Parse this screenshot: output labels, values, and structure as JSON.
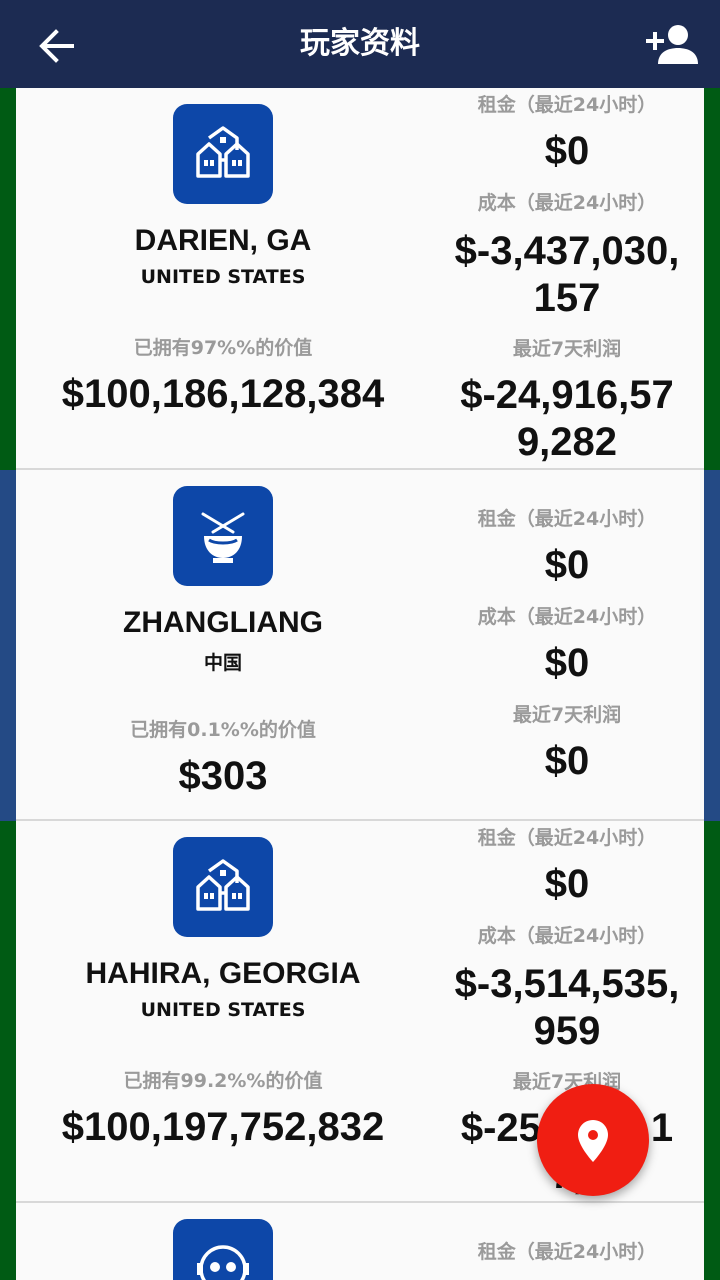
{
  "header": {
    "title": "玩家资料",
    "back_icon": "arrow-left-icon",
    "add_icon": "add-person-icon"
  },
  "labels": {
    "rent": "租金（最近24小时）",
    "cost": "成本（最近24小时）",
    "profit": "最近7天利润"
  },
  "properties": [
    {
      "icon": "houses-icon",
      "stripe_color": "#005b14",
      "name": "DARIEN, GA",
      "country": "UNITED STATES",
      "owned_label": "已拥有97%%的价值",
      "owned_value": "$100,186,128,384",
      "rent": "$0",
      "cost": "$-3,437,030,157",
      "profit": "$-24,916,579,282"
    },
    {
      "icon": "rice-bowl-icon",
      "stripe_color": "#244a85",
      "name": "ZHANGLIANG",
      "country": "中国",
      "owned_label": "已拥有0.1%%的价值",
      "owned_value": "$303",
      "rent": "$0",
      "cost": "$0",
      "profit": "$0"
    },
    {
      "icon": "houses-icon",
      "stripe_color": "#005b14",
      "name": "HAHIRA, GEORGIA",
      "country": "UNITED STATES",
      "owned_label": "已拥有99.2%%的价值",
      "owned_value": "$100,197,752,832",
      "rent": "$0",
      "cost": "$-3,514,535,959",
      "profit": "$-25,??,??1,7,??"
    },
    {
      "icon": "robot-icon",
      "stripe_color": "#005b14",
      "rent": ""
    }
  ],
  "fab": {
    "icon": "map-pin-icon"
  },
  "display": {
    "c0_cost_l1": "$-3,437,030,",
    "c0_cost_l2": "157",
    "c0_profit_l1": "$-24,916,57",
    "c0_profit_l2": "9,282",
    "c2_cost_l1": "$-3,514,535,",
    "c2_cost_l2": "959",
    "c2_profit_l1": "$-25",
    "c2_profit_l1b": "1",
    "c2_profit_l2": "7,"
  }
}
